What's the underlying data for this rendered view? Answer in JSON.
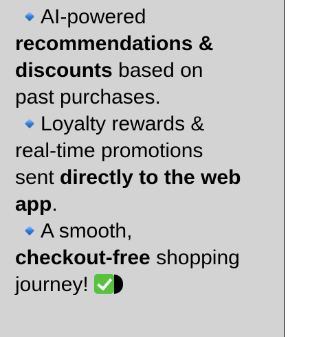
{
  "bullets": [
    {
      "icon": "small-blue-diamond-icon",
      "lines": [
        [
          {
            "t": "AI-powered",
            "b": false
          }
        ],
        [
          {
            "t": "recommendations &",
            "b": true
          }
        ],
        [
          {
            "t": "discounts",
            "b": true
          },
          {
            "t": " based on",
            "b": false
          }
        ],
        [
          {
            "t": "past purchases.",
            "b": false
          }
        ]
      ]
    },
    {
      "icon": "small-blue-diamond-icon",
      "lines": [
        [
          {
            "t": "Loyalty rewards &",
            "b": false
          }
        ],
        [
          {
            "t": "real-time promotions",
            "b": false
          }
        ],
        [
          {
            "t": "sent ",
            "b": false
          },
          {
            "t": "directly to the web",
            "b": true
          }
        ],
        [
          {
            "t": "app",
            "b": true
          },
          {
            "t": ".",
            "b": false
          }
        ]
      ]
    },
    {
      "icon": "small-blue-diamond-icon",
      "lines": [
        [
          {
            "t": "A smooth,",
            "b": false
          }
        ],
        [
          {
            "t": "checkout-free",
            "b": true
          },
          {
            "t": " shopping",
            "b": false
          }
        ],
        [
          {
            "t": "journey!",
            "b": false
          }
        ]
      ]
    }
  ],
  "trailing_icons": [
    "check-mark-button-icon",
    "half-moon-icon"
  ],
  "colors": {
    "cell_background": "#d3d3d3",
    "border": "#000000",
    "text": "#000000",
    "bullet": "#2f7ad8",
    "check": "#56c23e"
  }
}
